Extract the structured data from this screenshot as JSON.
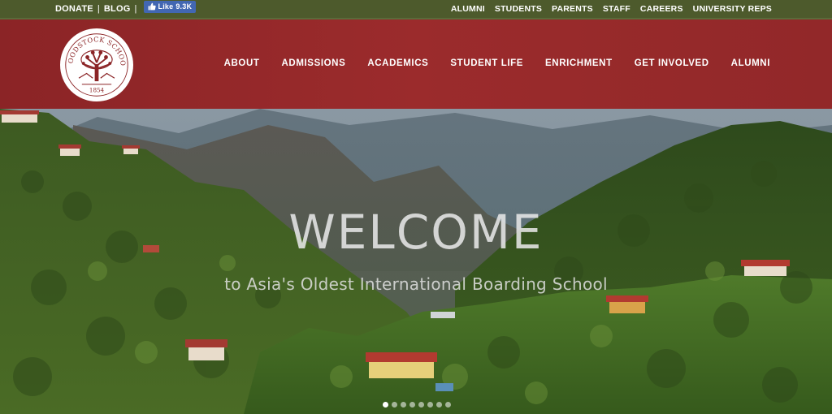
{
  "topbar": {
    "left_links": [
      {
        "label": "DONATE"
      },
      {
        "label": "BLOG"
      }
    ],
    "separator": "|",
    "fb_like": {
      "label": "Like",
      "count": "9.3K"
    },
    "right_links": [
      {
        "label": "ALUMNI"
      },
      {
        "label": "STUDENTS"
      },
      {
        "label": "PARENTS"
      },
      {
        "label": "STAFF"
      },
      {
        "label": "CAREERS"
      },
      {
        "label": "UNIVERSITY REPS"
      }
    ]
  },
  "logo": {
    "text_arc": "WOODSTOCK SCHOOL",
    "year": "1854"
  },
  "mainnav": [
    {
      "label": "ABOUT"
    },
    {
      "label": "ADMISSIONS"
    },
    {
      "label": "ACADEMICS"
    },
    {
      "label": "STUDENT LIFE"
    },
    {
      "label": "ENRICHMENT"
    },
    {
      "label": "GET INVOLVED"
    },
    {
      "label": "ALUMNI"
    }
  ],
  "hero": {
    "heading": "WELCOME",
    "subheading": "to Asia's Oldest International Boarding School",
    "slides_total": 8,
    "active_slide": 1
  },
  "colors": {
    "topbar": "#4d5a2c",
    "header": "#922829",
    "fb": "#4267b2"
  }
}
